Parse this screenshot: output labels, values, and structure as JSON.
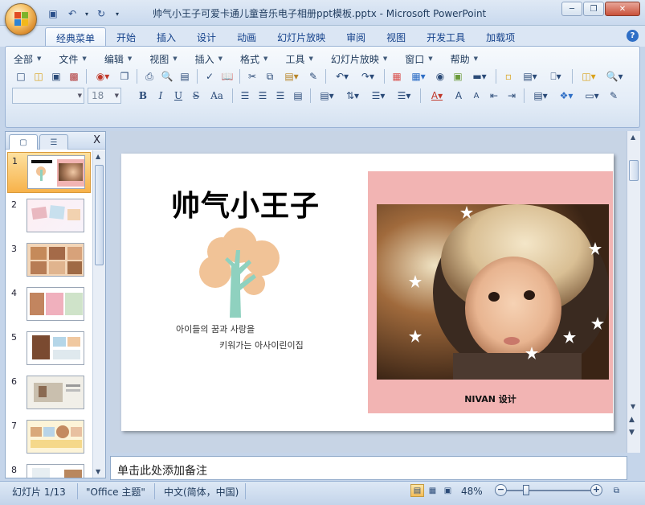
{
  "window": {
    "title": "帅气小王子可爱卡通儿童音乐电子相册ppt模板.pptx - Microsoft PowerPoint",
    "minimize": "─",
    "restore": "❐",
    "close": "✕"
  },
  "quick_access": [
    {
      "name": "save-icon",
      "glyph": "💾"
    },
    {
      "name": "undo-icon",
      "glyph": "↶"
    },
    {
      "name": "undo-dropdown-icon",
      "glyph": "▾"
    },
    {
      "name": "redo-icon",
      "glyph": "↻"
    },
    {
      "name": "customize-qat-icon",
      "glyph": "▾"
    }
  ],
  "ribbon_tabs": [
    "经典菜单",
    "开始",
    "插入",
    "设计",
    "动画",
    "幻灯片放映",
    "审阅",
    "视图",
    "开发工具",
    "加载项"
  ],
  "active_tab": "经典菜单",
  "classic_menu": [
    "全部",
    "文件",
    "编辑",
    "视图",
    "插入",
    "格式",
    "工具",
    "幻灯片放映",
    "窗口",
    "帮助"
  ],
  "font": {
    "name_placeholder": "",
    "size": "18"
  },
  "format_buttons": {
    "bold": "B",
    "italic": "I",
    "underline": "U",
    "strike": "S",
    "case": "Aa"
  },
  "slides_panel": {
    "tab_slides_icon": "slides-tab-icon",
    "tab_outline_icon": "outline-tab-icon",
    "close": "X",
    "thumbnails": [
      "1",
      "2",
      "3",
      "4",
      "5",
      "6",
      "7",
      "8"
    ],
    "selected": "1"
  },
  "slide": {
    "title": "帅气小王子",
    "korean_line1": "아이들의 꿈과 사랑을",
    "korean_line2": "키워가는 아사이린이집",
    "caption": "NIVAN 设计",
    "colors": {
      "frame": "#f2b4b3",
      "tree_trunk": "#8fd1bf",
      "tree_leaves": "#f1c397"
    }
  },
  "notes": {
    "placeholder": "单击此处添加备注"
  },
  "status": {
    "slide_info": "幻灯片 1/13",
    "theme": "\"Office 主题\"",
    "language": "中文(简体，中国)",
    "zoom": "48%",
    "zoom_out": "−",
    "zoom_in": "+"
  }
}
